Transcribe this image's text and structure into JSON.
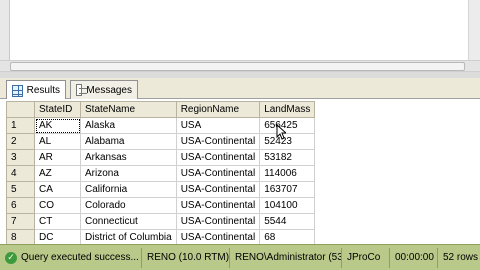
{
  "results_tabs": {
    "results_label": "Results",
    "messages_label": "Messages"
  },
  "grid": {
    "columns": [
      "StateID",
      "StateName",
      "RegionName",
      "LandMass"
    ],
    "rows": [
      {
        "num": "1",
        "StateID": "AK",
        "StateName": "Alaska",
        "RegionName": "USA",
        "LandMass": "656425"
      },
      {
        "num": "2",
        "StateID": "AL",
        "StateName": "Alabama",
        "RegionName": "USA-Continental",
        "LandMass": "52423"
      },
      {
        "num": "3",
        "StateID": "AR",
        "StateName": "Arkansas",
        "RegionName": "USA-Continental",
        "LandMass": "53182"
      },
      {
        "num": "4",
        "StateID": "AZ",
        "StateName": "Arizona",
        "RegionName": "USA-Continental",
        "LandMass": "114006"
      },
      {
        "num": "5",
        "StateID": "CA",
        "StateName": "California",
        "RegionName": "USA-Continental",
        "LandMass": "163707"
      },
      {
        "num": "6",
        "StateID": "CO",
        "StateName": "Colorado",
        "RegionName": "USA-Continental",
        "LandMass": "104100"
      },
      {
        "num": "7",
        "StateID": "CT",
        "StateName": "Connecticut",
        "RegionName": "USA-Continental",
        "LandMass": "5544"
      },
      {
        "num": "8",
        "StateID": "DC",
        "StateName": "District of Columbia",
        "RegionName": "USA-Continental",
        "LandMass": "68"
      }
    ]
  },
  "status_bar": {
    "message": "Query executed success...",
    "server": "RENO (10.0 RTM)",
    "user": "RENO\\Administrator (53)",
    "database": "JProCo",
    "elapsed": "00:00:00",
    "rows": "52 rows",
    "color": "#b9c98a"
  }
}
